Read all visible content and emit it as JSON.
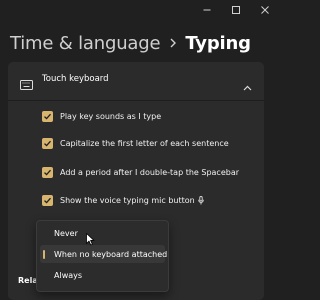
{
  "window": {
    "controls": [
      "minimize-icon",
      "maximize-icon",
      "close-icon"
    ]
  },
  "header": {
    "parent": "Time & language",
    "separator_icon": "chevron-right-icon",
    "current": "Typing"
  },
  "panel": {
    "icon": "keyboard-icon",
    "title": "Touch keyboard",
    "collapse_icon": "chevron-up-icon",
    "options": [
      {
        "label": "Play key sounds as I type",
        "checked": true
      },
      {
        "label": "Capitalize the first letter of each sentence",
        "checked": true
      },
      {
        "label": "Add a period after I double-tap the Spacebar",
        "checked": true
      },
      {
        "label": "Show the voice typing mic button",
        "checked": true,
        "icon": "microphone-icon"
      }
    ]
  },
  "dropdown": {
    "options": [
      "Never",
      "When no keyboard attached",
      "Always"
    ],
    "selected": "When no keyboard attached",
    "hovered": "Never"
  },
  "related": {
    "label": "Related"
  },
  "colors": {
    "background": "#202020",
    "card": "#2b2b2b",
    "accent": "#d8b56f",
    "text": "#ffffff"
  }
}
